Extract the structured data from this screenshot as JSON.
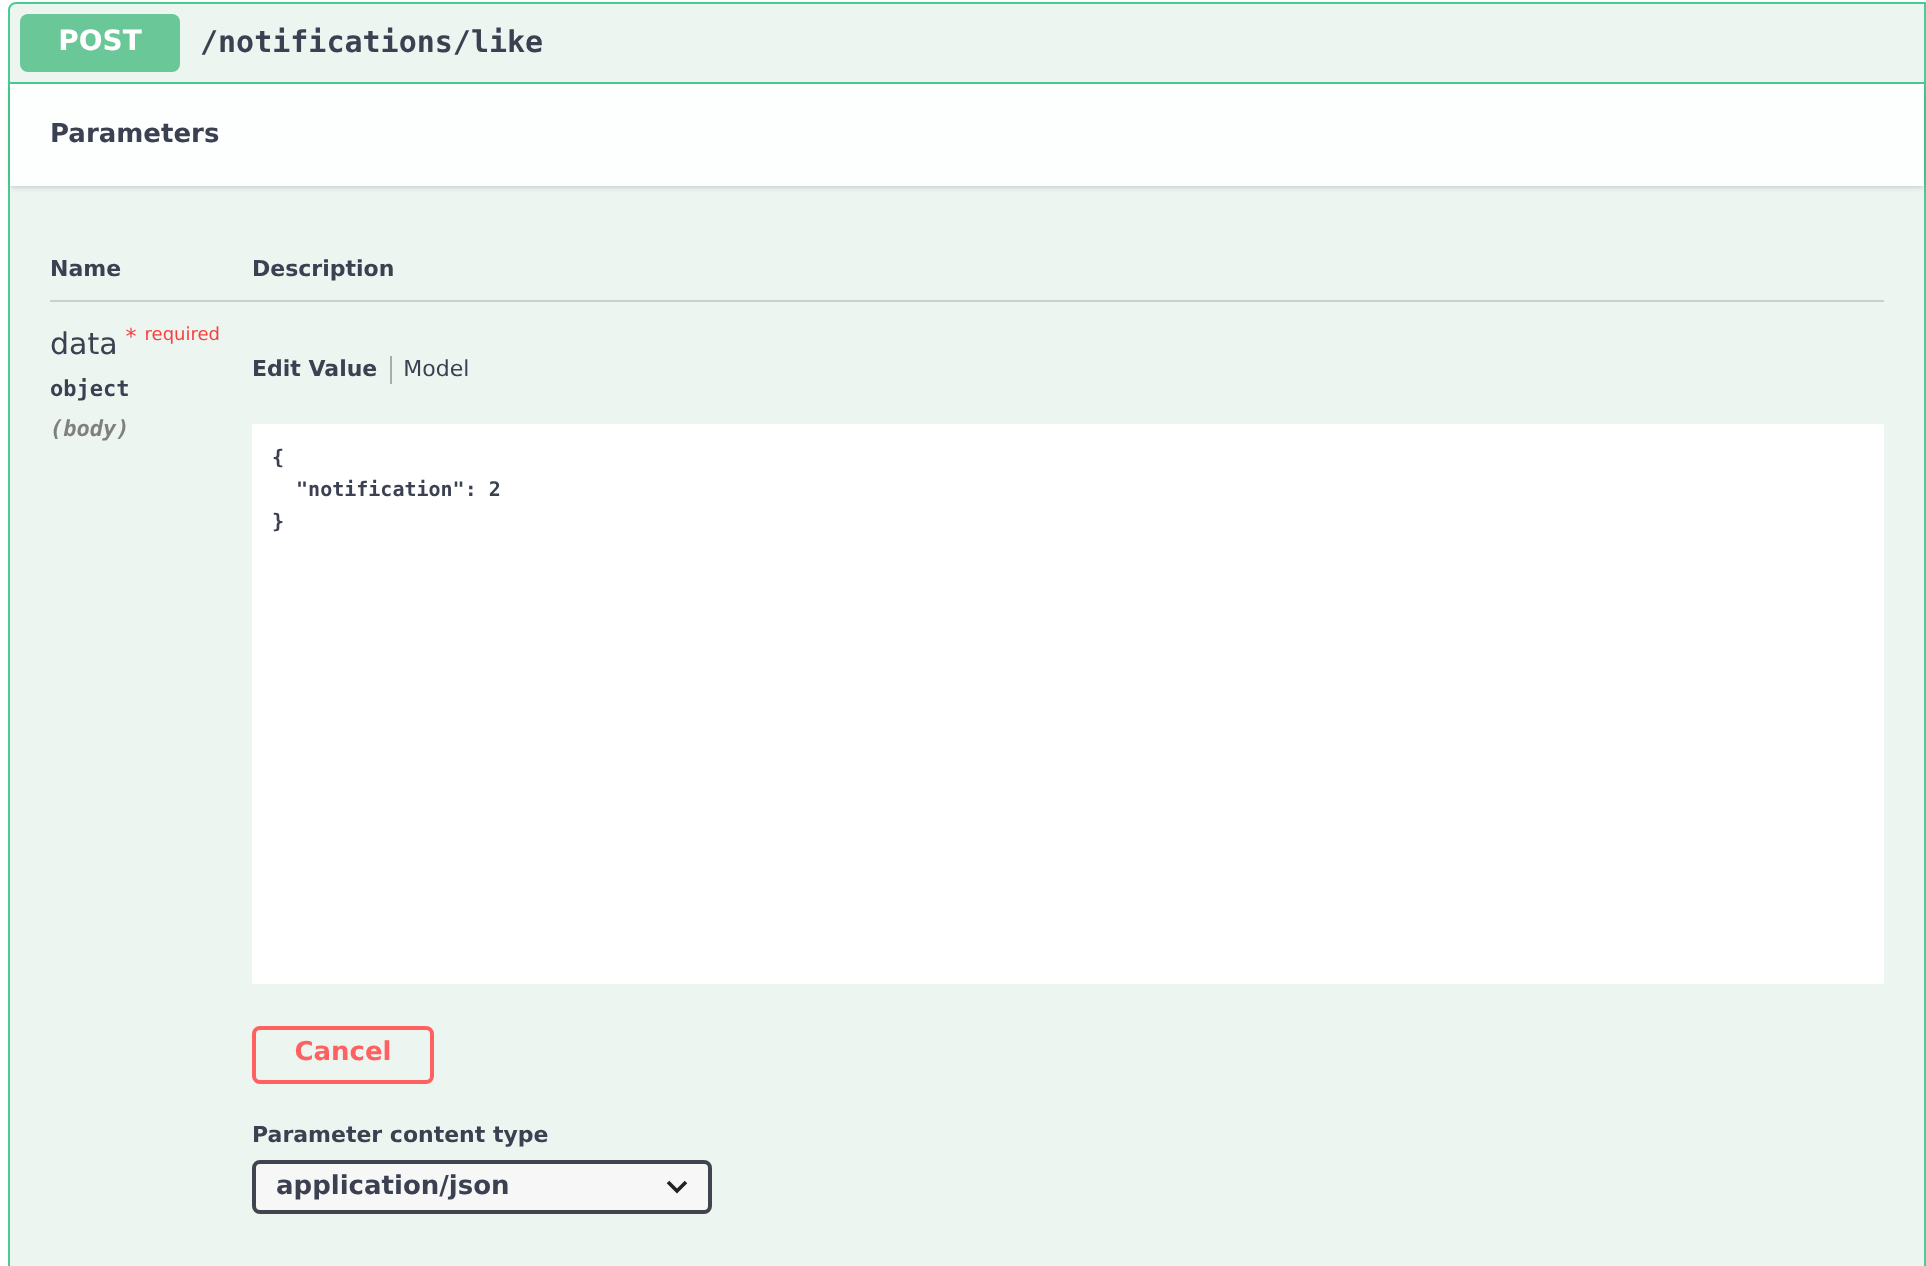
{
  "operation": {
    "method": "POST",
    "path": "/notifications/like"
  },
  "parameters_title": "Parameters",
  "columns": [
    "Name",
    "Description"
  ],
  "parameter": {
    "name": "data",
    "required_mark": "*",
    "required_label": "required",
    "type": "object",
    "location": "(body)"
  },
  "tabs": [
    {
      "label": "Edit Value",
      "selected": true
    },
    {
      "label": "Model",
      "selected": false
    }
  ],
  "body_value": "{\n  \"notification\": 2\n}",
  "cancel_button": "Cancel",
  "content_type": {
    "label": "Parameter content type",
    "value": "application/json"
  }
}
